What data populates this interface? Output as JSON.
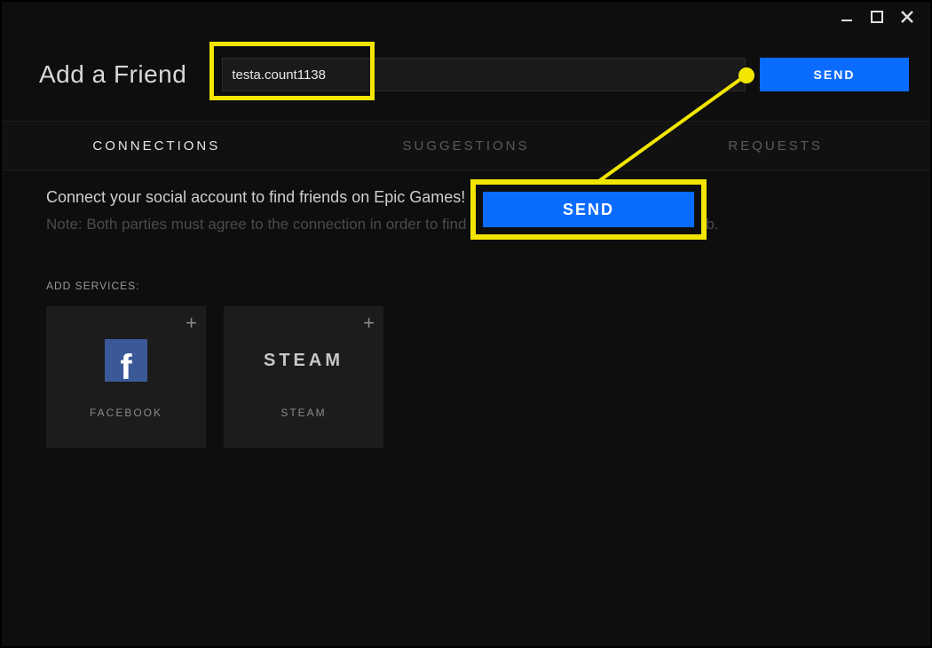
{
  "window": {
    "title": "Add a Friend"
  },
  "header": {
    "input_value": "testa.count1138",
    "input_placeholder": "",
    "send_label": "SEND"
  },
  "tabs": {
    "connections": "CONNECTIONS",
    "suggestions": "SUGGESTIONS",
    "requests": "REQUESTS",
    "active": "connections"
  },
  "content": {
    "lead": "Connect your social account to find friends on Epic Games!",
    "note": "Note: Both parties must agree to the connection in order to find each other on the \"Suggestions\" Tab.",
    "add_services_label": "ADD SERVICES:"
  },
  "services": [
    {
      "id": "facebook",
      "label": "FACEBOOK",
      "icon": "facebook"
    },
    {
      "id": "steam",
      "label": "STEAM",
      "icon": "steam-text",
      "icon_text": "STEAM"
    }
  ],
  "annotation": {
    "callout_label": "SEND"
  },
  "colors": {
    "accent_blue": "#0a6cff",
    "highlight_yellow": "#f2e600",
    "facebook_blue": "#3b5998"
  }
}
